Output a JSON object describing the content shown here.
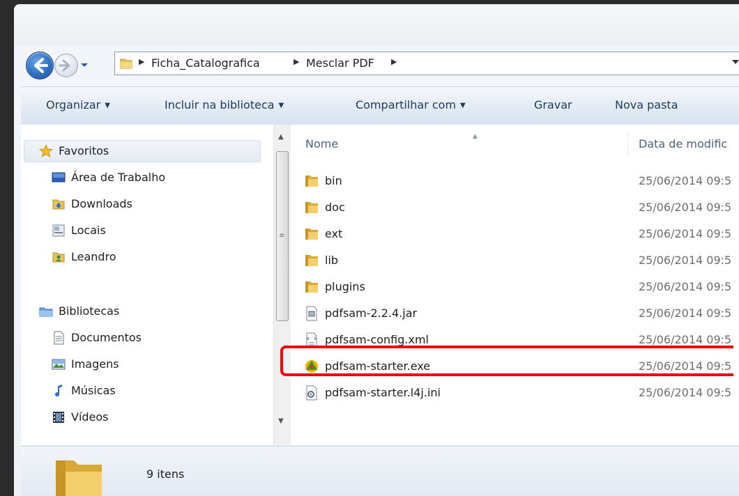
{
  "breadcrumb": [
    "Ficha_Catalografica",
    "Mesclar PDF"
  ],
  "toolbar": {
    "organize": "Organizar",
    "include_library": "Incluir na biblioteca",
    "share_with": "Compartilhar com",
    "burn": "Gravar",
    "new_folder": "Nova pasta"
  },
  "sidebar": {
    "favorites": {
      "label": "Favoritos",
      "items": [
        "Área de Trabalho",
        "Downloads",
        "Locais",
        "Leandro"
      ]
    },
    "libraries": {
      "label": "Bibliotecas",
      "items": [
        "Documentos",
        "Imagens",
        "Músicas",
        "Vídeos"
      ]
    }
  },
  "columns": {
    "name": "Nome",
    "date": "Data de modific"
  },
  "files": [
    {
      "name": "bin",
      "date": "25/06/2014 09:5",
      "type": "folder"
    },
    {
      "name": "doc",
      "date": "25/06/2014 09:5",
      "type": "folder"
    },
    {
      "name": "ext",
      "date": "25/06/2014 09:5",
      "type": "folder"
    },
    {
      "name": "lib",
      "date": "25/06/2014 09:5",
      "type": "folder"
    },
    {
      "name": "plugins",
      "date": "25/06/2014 09:5",
      "type": "folder"
    },
    {
      "name": "pdfsam-2.2.4.jar",
      "date": "25/06/2014 09:5",
      "type": "jar"
    },
    {
      "name": "pdfsam-config.xml",
      "date": "25/06/2014 09:5",
      "type": "xml"
    },
    {
      "name": "pdfsam-starter.exe",
      "date": "25/06/2014 09:5",
      "type": "exe"
    },
    {
      "name": "pdfsam-starter.l4j.ini",
      "date": "25/06/2014 09:5",
      "type": "ini"
    }
  ],
  "status": {
    "item_count": "9 itens"
  },
  "colors": {
    "highlight": "#e8000b",
    "toolbar_text": "#1e395b",
    "folder": "#e8c25a"
  }
}
